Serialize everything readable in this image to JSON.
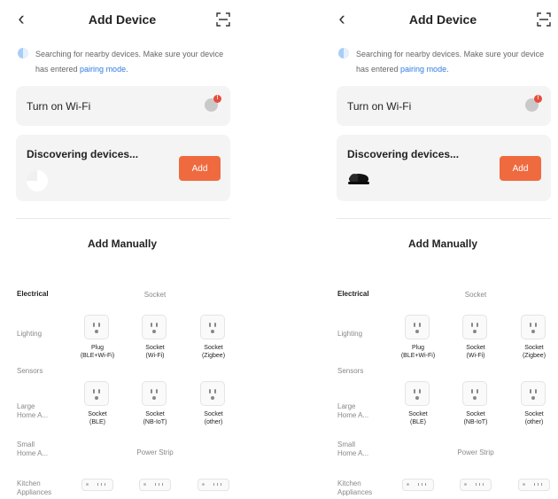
{
  "screens": [
    {
      "header": {
        "back_icon": "‹",
        "title": "Add Device",
        "scan_icon": "scan-icon"
      },
      "notice": {
        "text": "Searching for nearby devices. Make sure your device has entered ",
        "link": "pairing mode",
        "end": "."
      },
      "wifi_card": {
        "label": "Turn on Wi-Fi",
        "badge": "!"
      },
      "discover_card": {
        "label": "Discovering devices...",
        "add_label": "Add",
        "state": "searching"
      },
      "manual_title": "Add Manually"
    },
    {
      "header": {
        "back_icon": "‹",
        "title": "Add Device",
        "scan_icon": "scan-icon"
      },
      "notice": {
        "text": "Searching for nearby devices. Make sure your device has entered ",
        "link": "pairing mode",
        "end": "."
      },
      "wifi_card": {
        "label": "Turn on Wi-Fi",
        "badge": "!"
      },
      "discover_card": {
        "label": "Discovering devices...",
        "add_label": "Add",
        "state": "found"
      },
      "manual_title": "Add Manually"
    }
  ],
  "categories": [
    {
      "label": "Electrical",
      "active": true
    },
    {
      "label": "Lighting",
      "active": false
    },
    {
      "label": "Sensors",
      "active": false
    },
    {
      "label": "Large\nHome A...",
      "active": false
    },
    {
      "label": "Small\nHome A...",
      "active": false
    },
    {
      "label": "Kitchen\nAppliances",
      "active": false
    }
  ],
  "sections": {
    "socket": "Socket",
    "power_strip": "Power Strip"
  },
  "devices": [
    {
      "label": "Plug\n(BLE+Wi-Fi)"
    },
    {
      "label": "Socket\n(Wi-Fi)"
    },
    {
      "label": "Socket\n(Zigbee)"
    },
    {
      "label": "Socket\n(BLE)"
    },
    {
      "label": "Socket\n(NB-IoT)"
    },
    {
      "label": "Socket\n(other)"
    }
  ]
}
